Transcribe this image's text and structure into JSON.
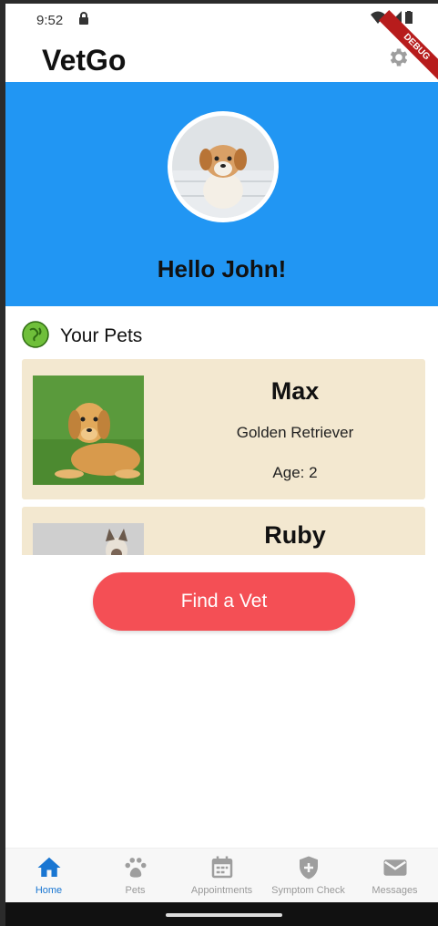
{
  "status_bar": {
    "time": "9:52"
  },
  "app_bar": {
    "title": "VetGo",
    "debug_label": "DEBUG"
  },
  "header": {
    "greeting": "Hello John!"
  },
  "pets_section": {
    "title": "Your Pets",
    "pets": [
      {
        "name": "Max",
        "breed": "Golden Retriever",
        "age": "Age: 2"
      },
      {
        "name": "Ruby"
      }
    ]
  },
  "cta": {
    "label": "Find a Vet"
  },
  "bottom_nav": {
    "items": [
      {
        "label": "Home",
        "icon": "home-icon",
        "active": true
      },
      {
        "label": "Pets",
        "icon": "paw-icon"
      },
      {
        "label": "Appointments",
        "icon": "calendar-icon"
      },
      {
        "label": "Symptom Check",
        "icon": "shield-icon"
      },
      {
        "label": "Messages",
        "icon": "mail-icon"
      }
    ]
  },
  "colors": {
    "header_bg": "#2196f3",
    "card_bg": "#f3e8d0",
    "cta_bg": "#f44f55",
    "active_nav": "#1976d2",
    "inactive_nav": "#9e9e9e"
  }
}
